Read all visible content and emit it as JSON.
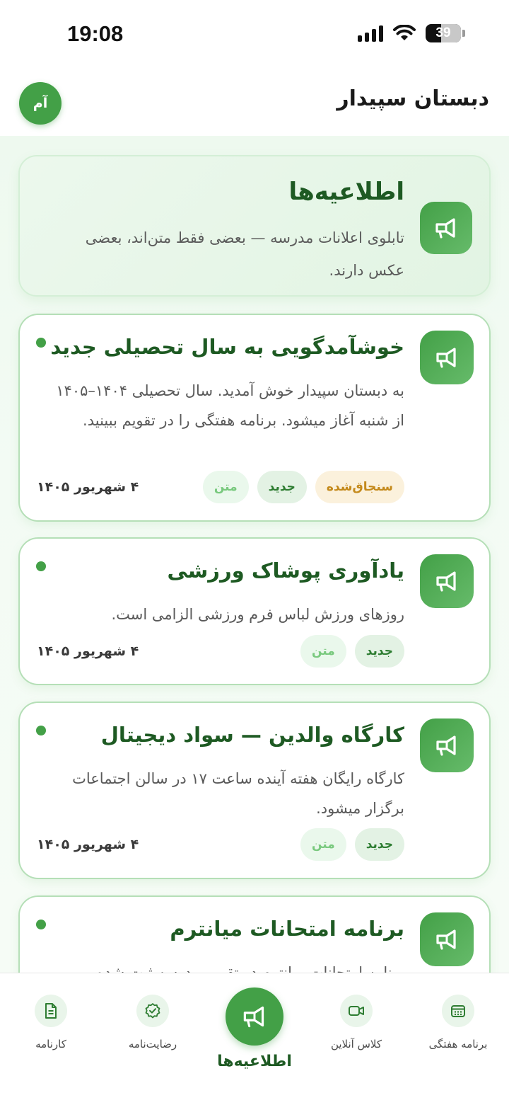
{
  "status": {
    "time": "19:08",
    "battery": "39"
  },
  "header": {
    "title": "دبستان سپیدار",
    "avatar": "آم"
  },
  "hero": {
    "title": "اطلاعیه‌ها",
    "subtitle": "تابلوی اعلانات مدرسه — بعضی فقط متن‌اند، بعضی عکس دارند."
  },
  "announcements": [
    {
      "title": "خوشآمدگویی به سال تحصیلی جدید",
      "body": "به دبستان سپیدار خوش آمدید. سال تحصیلی ۱۴۰۴–۱۴۰۵ از شنبه آغاز میشود. برنامه هفتگی را در تقویم ببینید.",
      "tags": [
        "سنجاق‌شده",
        "جدید",
        "متن"
      ],
      "date": "۴ شهریور ۱۴۰۵"
    },
    {
      "title": "یادآوری پوشاک ورزشی",
      "body": "روزهای ورزش لباس فرم ورزشی الزامی است.",
      "tags": [
        "جدید",
        "متن"
      ],
      "date": "۴ شهریور ۱۴۰۵"
    },
    {
      "title": "کارگاه والدین — سواد دیجیتال",
      "body": "کارگاه رایگان هفته آینده ساعت ۱۷ در سالن اجتماعات برگزار میشود.",
      "tags": [
        "جدید",
        "متن"
      ],
      "date": "۴ شهریور ۱۴۰۵"
    },
    {
      "title": "برنامه امتحانات میانترم",
      "body": "برنامه امتحانات میانترم در تقویم مدرسه ثبت شده",
      "tags": [],
      "date": ""
    }
  ],
  "nav": {
    "weekly": "برنامه هفتگی",
    "online": "کلاس آنلاین",
    "announcements": "اطلاعیه‌ها",
    "consent": "رضایت‌نامه",
    "report": "کارنامه"
  },
  "colors": {
    "primary": "#43a047",
    "title_green": "#1e5a23",
    "pinned_tag_bg": "#fbf1dc",
    "pinned_tag_fg": "#c48a1c"
  }
}
